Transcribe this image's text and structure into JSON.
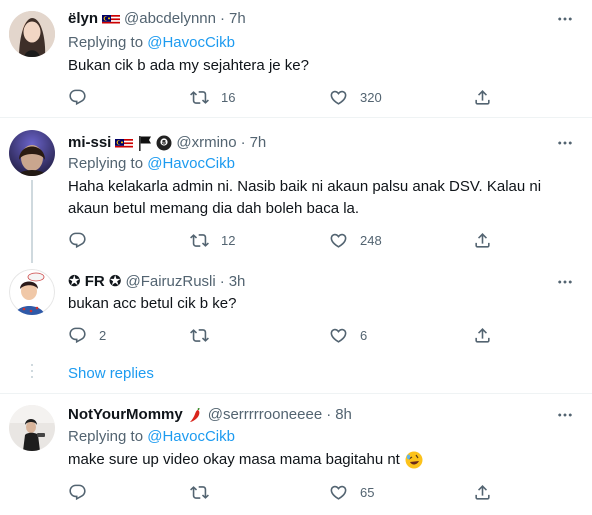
{
  "tweets": [
    {
      "name": "ëlyn",
      "handle": "@abcdelynnn",
      "time": "7h",
      "replying_prefix": "Replying to",
      "replying_to": "@HavocCikb",
      "text": "Bukan cik b ada my sejahtera je ke?",
      "replies": "",
      "retweets": "16",
      "likes": "320"
    },
    {
      "name": "mi-ssi",
      "handle": "@xrmino",
      "time": "7h",
      "replying_prefix": "Replying to",
      "replying_to": "@HavocCikb",
      "text": "Haha kelakarla admin ni. Nasib baik ni akaun palsu anak DSV. Kalau ni akaun betul memang dia dah boleh baca la.",
      "replies": "",
      "retweets": "12",
      "likes": "248"
    },
    {
      "name": "✪ FR ✪",
      "handle": "@FairuzRusli",
      "time": "3h",
      "text": "bukan acc betul cik b ke?",
      "replies": "2",
      "retweets": "",
      "likes": "6"
    },
    {
      "name": "NotYourMommy",
      "handle": "@serrrrrooneeee",
      "time": "8h",
      "replying_prefix": "Replying to",
      "replying_to": "@HavocCikb",
      "text": "make sure up video okay masa mama bagitahu nt",
      "replies": "",
      "retweets": "",
      "likes": "65"
    }
  ],
  "show_replies": "Show replies",
  "separator": "·",
  "colors": {
    "link": "#1d9bf0",
    "secondary": "#536471",
    "primary": "#0f1419",
    "border": "#eff3f4"
  },
  "icons": [
    "reply-icon",
    "retweet-icon",
    "like-icon",
    "share-icon",
    "more-icon",
    "malaysia-flag-icon",
    "black-flag-icon",
    "8ball-icon",
    "chili-icon",
    "rofl-emoji-icon"
  ]
}
